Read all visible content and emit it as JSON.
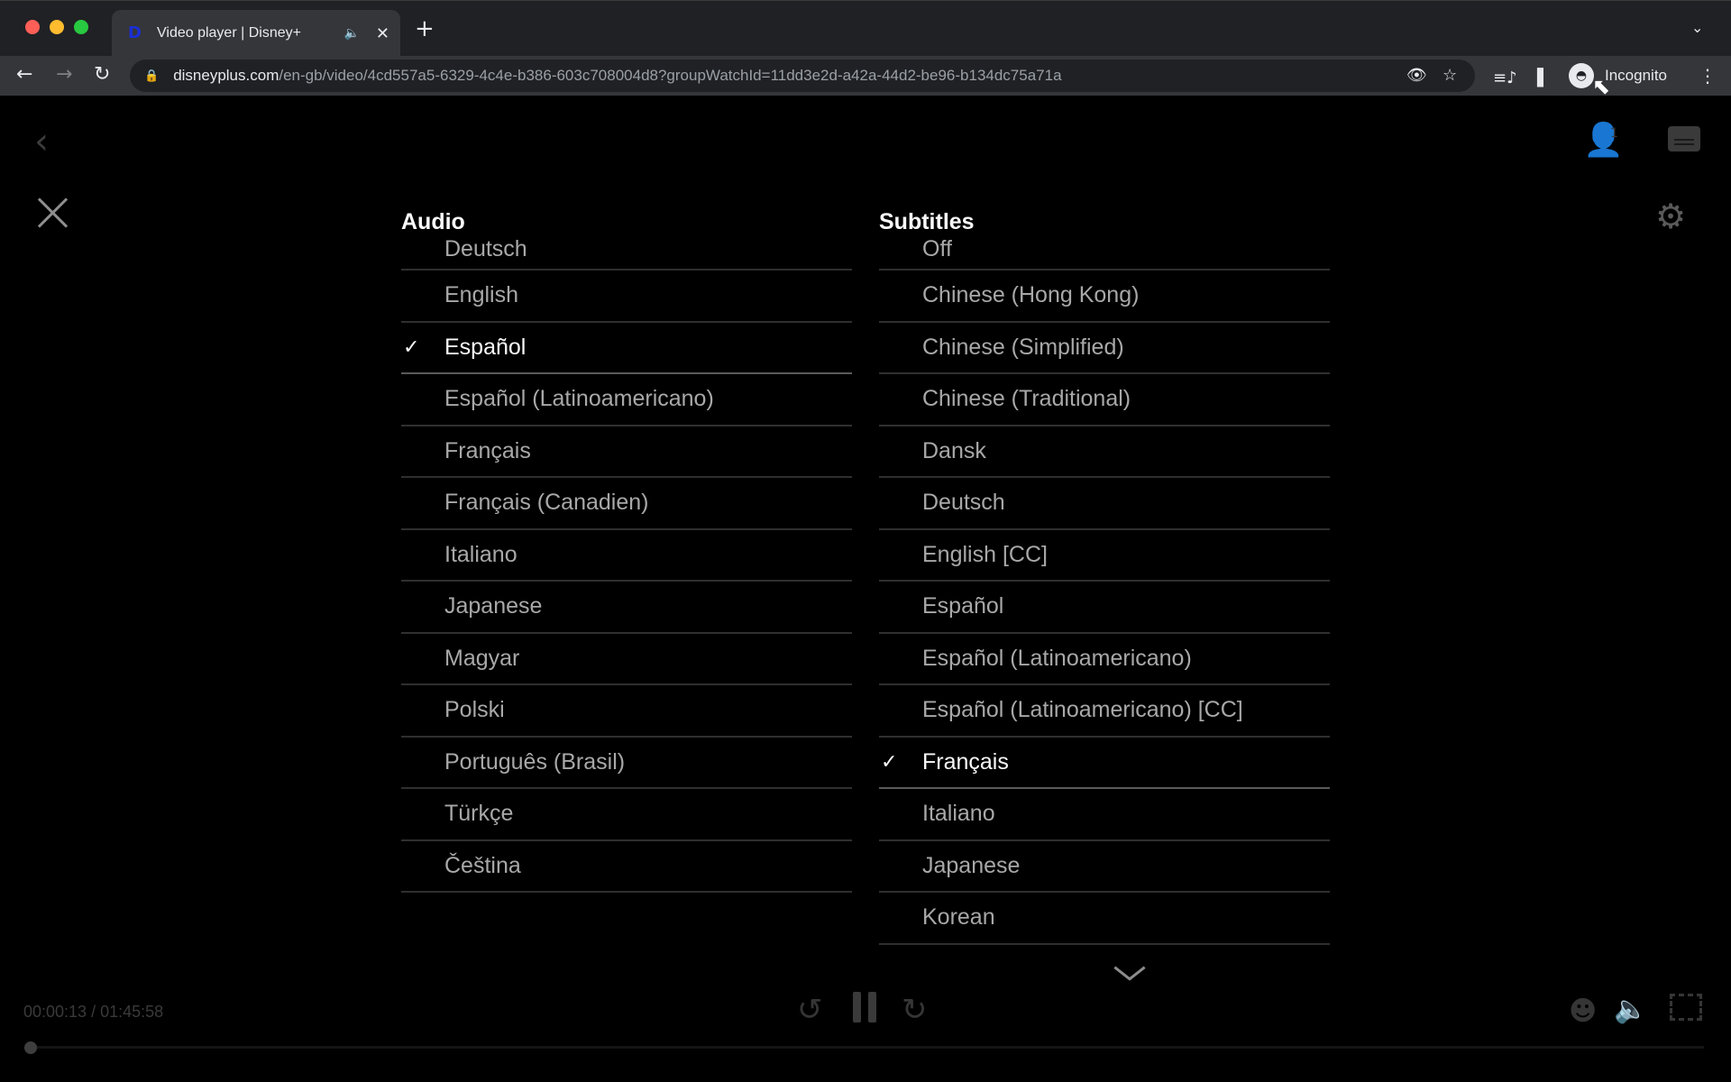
{
  "browser": {
    "tab": {
      "title": "Video player | Disney+",
      "favicon": "disney-plus-icon",
      "audio_icon": "speaker-icon",
      "close_icon": "close-icon"
    },
    "new_tab_icon": "plus-icon",
    "tab_search_icon": "chevron-down-icon",
    "nav": {
      "back": "←",
      "forward": "→",
      "reload": "↻"
    },
    "url": {
      "host": "disneyplus.com",
      "path": "/en-gb/video/4cd557a5-6329-4c4e-b386-603c708004d8?groupWatchId=11dd3e2d-a42a-44d2-be96-b134dc75a71a"
    },
    "profile_label": "Incognito"
  },
  "player": {
    "group_watch_count": "1",
    "time_display": "00:00:13 / 01:45:58",
    "progress_fraction": 0.002
  },
  "audio": {
    "heading": "Audio",
    "selected": "Español",
    "items": [
      "Deutsch",
      "English",
      "Español",
      "Español (Latinoamericano)",
      "Français",
      "Français (Canadien)",
      "Italiano",
      "Japanese",
      "Magyar",
      "Polski",
      "Português (Brasil)",
      "Türkçe",
      "Čeština"
    ]
  },
  "subtitles": {
    "heading": "Subtitles",
    "selected": "Français",
    "items": [
      "Off",
      "Chinese (Hong Kong)",
      "Chinese (Simplified)",
      "Chinese (Traditional)",
      "Dansk",
      "Deutsch",
      "English [CC]",
      "Español",
      "Español (Latinoamericano)",
      "Español (Latinoamericano) [CC]",
      "Français",
      "Italiano",
      "Japanese",
      "Korean"
    ]
  },
  "icons": {
    "check": "✓",
    "back_chevron": "‹",
    "gear": "⚙",
    "rewind": "↺",
    "forward": "↻",
    "volume": "🔈",
    "cursor": "➚"
  }
}
